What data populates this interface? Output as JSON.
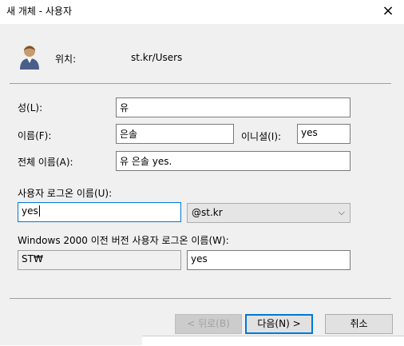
{
  "window": {
    "title": "새 개체 - 사용자",
    "close_icon": "×"
  },
  "location": {
    "label": "위치:",
    "value": "st.kr/Users"
  },
  "last_name": {
    "label": "성(L):",
    "value": "유"
  },
  "first_name": {
    "label": "이름(F):",
    "value": "은솔"
  },
  "initials": {
    "label": "이니셜(I):",
    "value": "yes"
  },
  "full_name": {
    "label": "전체 이름(A):",
    "value": "유 은솔 yes."
  },
  "logon_name": {
    "label": "사용자 로그온 이름(U):",
    "value": "yes"
  },
  "upn_suffix": {
    "selected": "@st.kr",
    "chevron": "⌵"
  },
  "pre2000": {
    "label": "Windows 2000 이전 버전 사용자 로그온 이름(W):",
    "domain": "ST₩",
    "value": "yes"
  },
  "buttons": {
    "back": "< 뒤로(B)",
    "next": "다음(N) >",
    "cancel": "취소"
  },
  "colors": {
    "accent": "#0078d7",
    "dialog_bg": "#f0f0f0"
  }
}
